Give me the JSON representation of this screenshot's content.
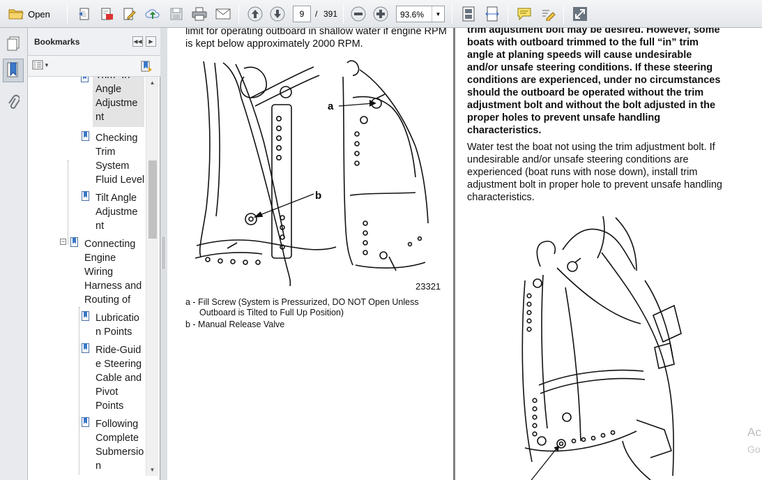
{
  "toolbar": {
    "open_label": "Open",
    "current_page": "9",
    "page_separator": "/",
    "total_pages": "391",
    "zoom_value": "93.6%"
  },
  "bookmarks": {
    "title": "Bookmarks",
    "items": [
      {
        "label": "Trim “In”"
      },
      {
        "label": "Angle"
      },
      {
        "label": "Adjustme"
      },
      {
        "label": "nt"
      },
      {
        "label": "Checking"
      },
      {
        "label": "Trim"
      },
      {
        "label": "System"
      },
      {
        "label": "Fluid Level"
      },
      {
        "label": "Tilt Angle"
      },
      {
        "label": "Adjustme"
      },
      {
        "label": "nt"
      },
      {
        "label": "Connecting"
      },
      {
        "label": "Engine"
      },
      {
        "label": "Wiring"
      },
      {
        "label": "Harness and"
      },
      {
        "label": "Routing of"
      },
      {
        "label": "Lubricatio"
      },
      {
        "label": "n Points"
      },
      {
        "label": "Ride-Guid"
      },
      {
        "label": "e Steering"
      },
      {
        "label": "Cable and"
      },
      {
        "label": "Pivot"
      },
      {
        "label": "Points"
      },
      {
        "label": "Following"
      },
      {
        "label": "Complete"
      },
      {
        "label": "Submersio"
      },
      {
        "label": "n"
      }
    ]
  },
  "document": {
    "left_page": {
      "intro": "limit for operating outboard in shallow water if engine RPM is kept below approximately 2000 RPM.",
      "figure_label_a": "a",
      "figure_label_b": "b",
      "figure_number": "23321",
      "caption_a": "a - Fill Screw (System is Pressurized, DO NOT Open Unless Outboard is Tilted to Full Up Position)",
      "caption_b": "b - Manual Release Valve"
    },
    "right_page": {
      "warning": "trim adjustment bolt may be desired. However, some boats with outboard trimmed to the full “in” trim angle at planing speeds will cause undesirable and/or unsafe steering conditions. If these steering conditions are experienced, under no circumstances should the outboard be operated without the trim adjustment bolt and without the bolt adjusted in the proper holes to prevent unsafe handling characteristics.",
      "water_test": "Water test the boat not using the trim adjustment bolt. If undesirable and/or unsafe steering conditions are experienced (boat runs with nose down), install trim adjustment bolt in proper hole to prevent unsafe handling characteristics."
    },
    "watermark_line1": "Ac",
    "watermark_line2": "Go"
  }
}
